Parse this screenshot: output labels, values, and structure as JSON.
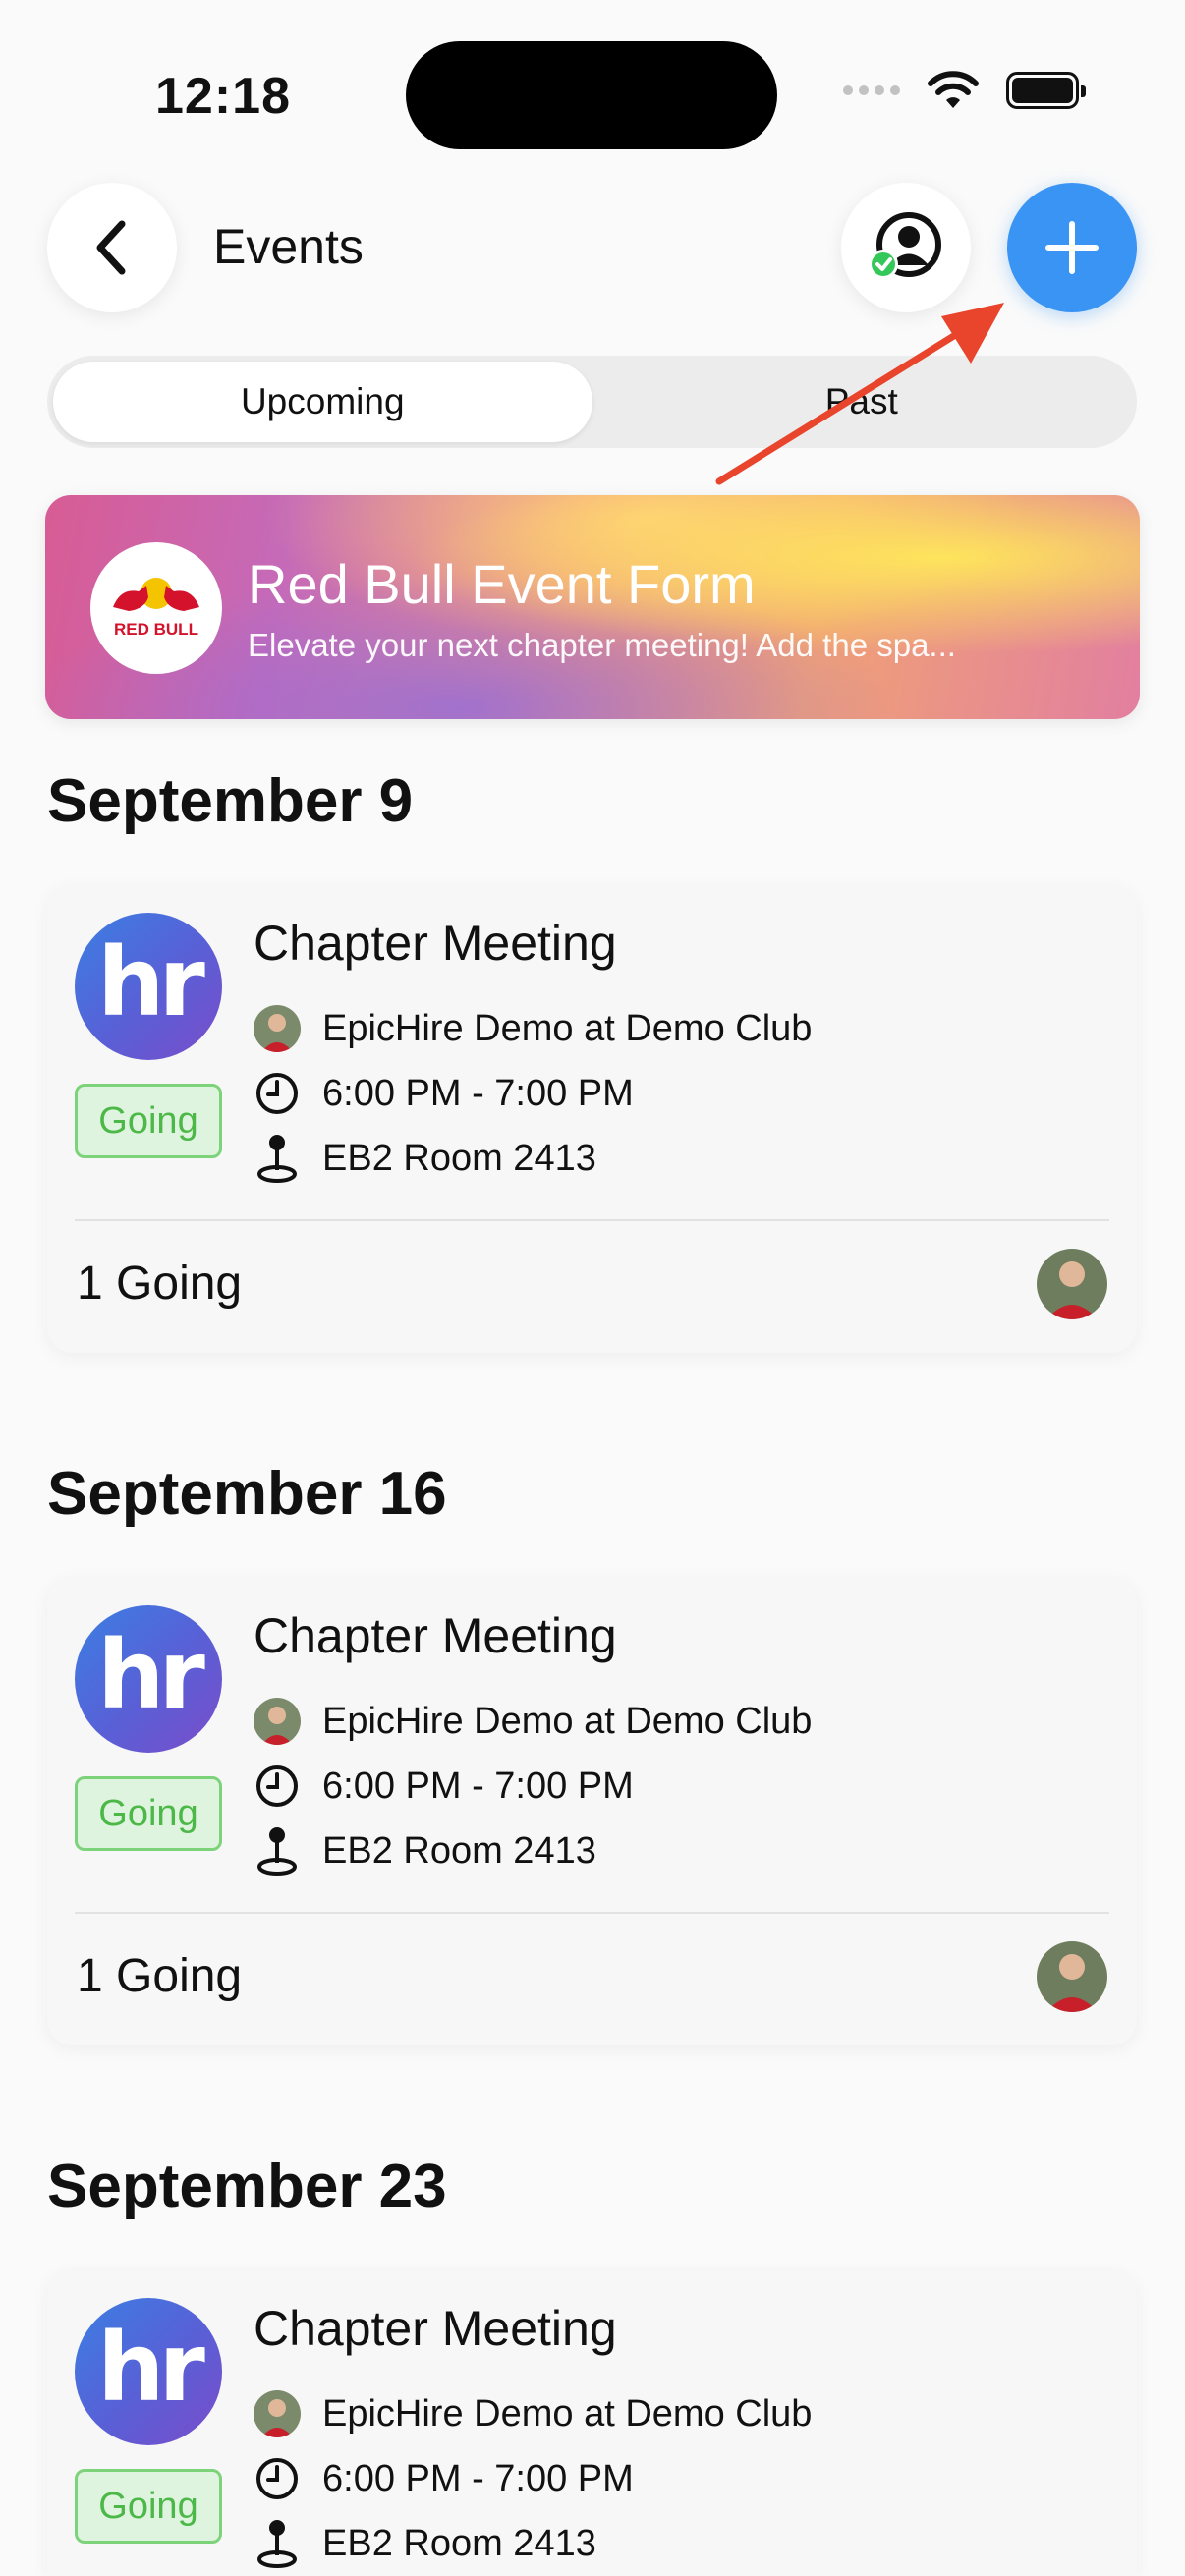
{
  "status_bar": {
    "time": "12:18"
  },
  "header": {
    "title": "Events"
  },
  "tabs": [
    {
      "label": "Upcoming",
      "active": true
    },
    {
      "label": "Past",
      "active": false
    }
  ],
  "banner": {
    "title": "Red Bull Event Form",
    "subtitle": "Elevate your next chapter meeting! Add the spa...",
    "logo_text": "RED BULL"
  },
  "sections": [
    {
      "date": "September 9",
      "event": {
        "title": "Chapter Meeting",
        "logo_text": "hr",
        "status": "Going",
        "host": "EpicHire Demo",
        "at": "at",
        "club": "Demo Club",
        "time": "6:00 PM - 7:00 PM",
        "location": "EB2 Room 2413",
        "going_count": "1 Going"
      }
    },
    {
      "date": "September 16",
      "event": {
        "title": "Chapter Meeting",
        "logo_text": "hr",
        "status": "Going",
        "host": "EpicHire Demo",
        "at": "at",
        "club": "Demo Club",
        "time": "6:00 PM - 7:00 PM",
        "location": "EB2 Room 2413",
        "going_count": "1 Going"
      }
    },
    {
      "date": "September 23",
      "event": {
        "title": "Chapter Meeting",
        "logo_text": "hr",
        "status": "Going",
        "host": "EpicHire Demo",
        "at": "at",
        "club": "Demo Club",
        "time": "6:00 PM - 7:00 PM",
        "location": "EB2 Room 2413"
      }
    }
  ],
  "colors": {
    "accent": "#3a94f4",
    "going_green": "#4bb848",
    "annotation_arrow": "#e8452c"
  },
  "icons": [
    "chevron-left-icon",
    "profile-check-icon",
    "plus-icon",
    "clock-icon",
    "map-pin-icon",
    "wifi-icon",
    "battery-icon"
  ]
}
